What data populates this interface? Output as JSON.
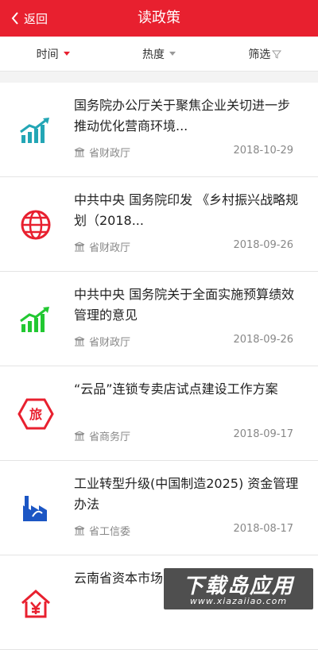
{
  "header": {
    "back_label": "返回",
    "title": "读政策"
  },
  "filters": [
    {
      "label": "时间",
      "active": true
    },
    {
      "label": "热度",
      "active": false
    },
    {
      "label": "筛选",
      "active": false
    }
  ],
  "items": [
    {
      "title": "国务院办公厅关于聚焦企业关切进一步推动优化营商环境...",
      "source": "省财政厅",
      "date": "2018-10-29",
      "icon": "trend-chart-icon"
    },
    {
      "title": "中共中央 国务院印发 《乡村振兴战略规划（2018...",
      "source": "省财政厅",
      "date": "2018-09-26",
      "icon": "globe-icon"
    },
    {
      "title": "中共中央 国务院关于全面实施预算绩效管理的意见",
      "source": "省财政厅",
      "date": "2018-09-26",
      "icon": "growth-chart-icon"
    },
    {
      "title": "“云品”连锁专卖店试点建设工作方案",
      "source": "省商务厅",
      "date": "2018-09-17",
      "icon": "travel-badge-icon"
    },
    {
      "title": "工业转型升级(中国制造2025) 资金管理办法",
      "source": "省工信委",
      "date": "2018-08-17",
      "icon": "factory-icon"
    },
    {
      "title": "云南省资本市场",
      "source": "",
      "date": "",
      "icon": "yuan-house-icon"
    }
  ],
  "colors": {
    "accent": "#e8202f",
    "teal": "#23a6b5",
    "green": "#22c832",
    "blue": "#1c56c4"
  },
  "watermark": {
    "main": "下载岛应用",
    "url": "www.xiazaiiao.com"
  }
}
